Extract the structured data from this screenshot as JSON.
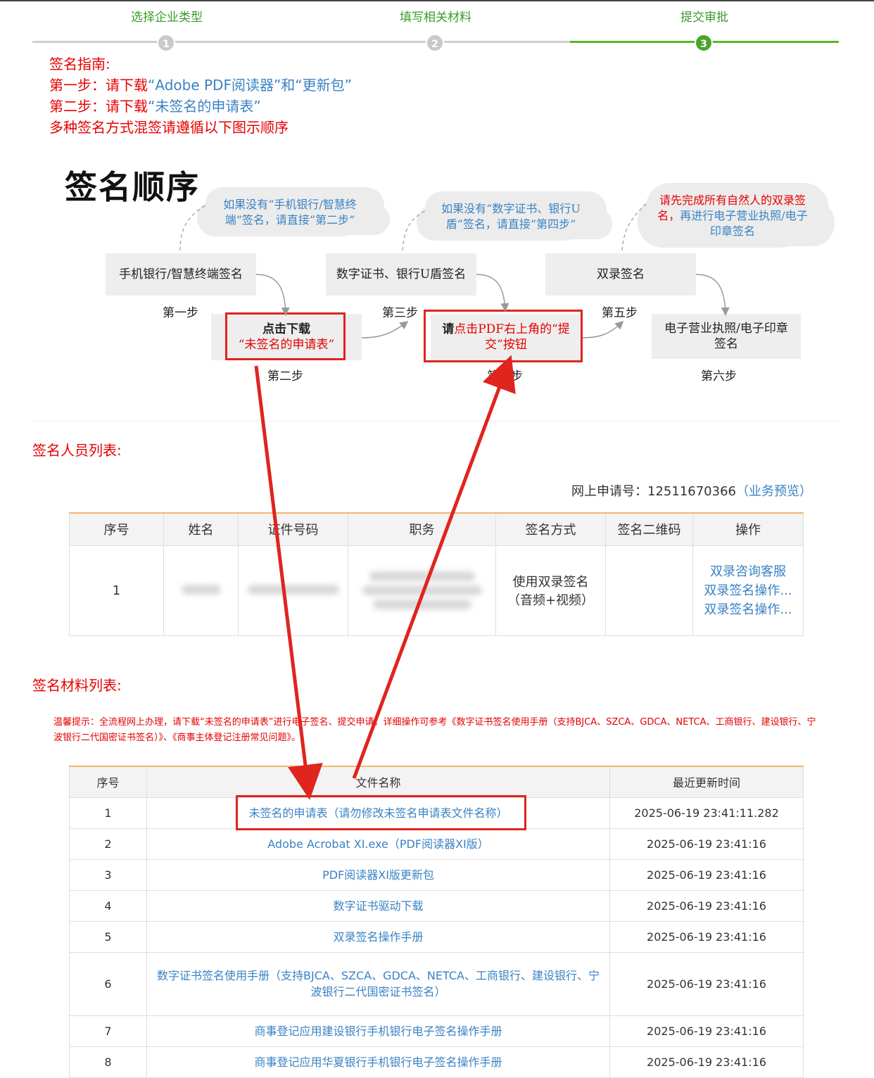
{
  "stepper": {
    "steps": [
      {
        "num": "1",
        "label": "选择企业类型"
      },
      {
        "num": "2",
        "label": "填写相关材料"
      },
      {
        "num": "3",
        "label": "提交审批"
      }
    ]
  },
  "guide": {
    "title": "签名指南:",
    "line1_prefix": "第一步：请下载",
    "line1_link": "“Adobe PDF阅读器”和“更新包”",
    "line2_prefix": "第二步：请下载",
    "line2_link": "“未签名的申请表”",
    "line3": "多种签名方式混签请遵循以下图示顺序"
  },
  "diagram": {
    "title": "签名顺序",
    "cloud1": "如果没有“手机银行/智慧终端”签名，请直接“第二步”",
    "cloud2": "如果没有“数字证书、银行U盾”签名，请直接“第四步”",
    "cloud3_red": "请先完成所有自然人的双录签名，",
    "cloud3_blue": "再进行电子营业执照/电子印章签名",
    "box1": "手机银行/智慧终端签名",
    "box2_line1": "点击下载",
    "box2_line2": "“未签名的申请表”",
    "box3": "数字证书、银行U盾签名",
    "box4_prefix": "请",
    "box4_red": "点击PDF右上角的“提交”按钮",
    "box5": "双录签名",
    "box6": "电子营业执照/电子印章签名",
    "step1": "第一步",
    "step2": "第二步",
    "step3": "第三步",
    "step4": "第四步",
    "step5": "第五步",
    "step6": "第六步"
  },
  "signers_section": {
    "title": "签名人员列表:",
    "app_no_label": "网上申请号：",
    "app_no": "12511670366",
    "preview_link": "（业务预览）",
    "headers": [
      "序号",
      "姓名",
      "证件号码",
      "职务",
      "签名方式",
      "签名二维码",
      "操作"
    ],
    "row": {
      "index": "1",
      "sign_method_line1": "使用双录签名",
      "sign_method_line2": "（音频+视频）",
      "ops": [
        "双录咨询客服",
        "双录签名操作...",
        "双录签名操作..."
      ]
    }
  },
  "materials_section": {
    "title": "签名材料列表:",
    "tip": "温馨提示：全流程网上办理，请下载“未签名的申请表”进行电子签名、提交申请。详细操作可参考《数字证书签名使用手册（支持BJCA、SZCA、GDCA、NETCA、工商银行、建设银行、宁波银行二代国密证书签名）》、《商事主体登记注册常见问题》。",
    "headers": [
      "序号",
      "文件名称",
      "最近更新时间"
    ],
    "rows": [
      {
        "index": "1",
        "name": "未签名的申请表（请勿修改未签名申请表文件名称）",
        "time": "2025-06-19 23:41:11.282"
      },
      {
        "index": "2",
        "name": "Adobe Acrobat XI.exe（PDF阅读器XI版）",
        "time": "2025-06-19 23:41:16"
      },
      {
        "index": "3",
        "name": "PDF阅读器XI版更新包",
        "time": "2025-06-19 23:41:16"
      },
      {
        "index": "4",
        "name": "数字证书驱动下载",
        "time": "2025-06-19 23:41:16"
      },
      {
        "index": "5",
        "name": "双录签名操作手册",
        "time": "2025-06-19 23:41:16"
      },
      {
        "index": "6",
        "name": "数字证书签名使用手册（支持BJCA、SZCA、GDCA、NETCA、工商银行、建设银行、宁波银行二代国密证书签名）",
        "time": "2025-06-19 23:41:16"
      },
      {
        "index": "7",
        "name": "商事登记应用建设银行手机银行电子签名操作手册",
        "time": "2025-06-19 23:41:16"
      },
      {
        "index": "8",
        "name": "商事登记应用华夏银行手机银行电子签名操作手册",
        "time": "2025-06-19 23:41:16"
      }
    ]
  },
  "colors": {
    "accent_green": "#59b52a",
    "warning_red": "#e60000",
    "link_blue": "#3a82c4",
    "table_top_border": "#f2b66a",
    "annotation_red": "#e0241e"
  }
}
